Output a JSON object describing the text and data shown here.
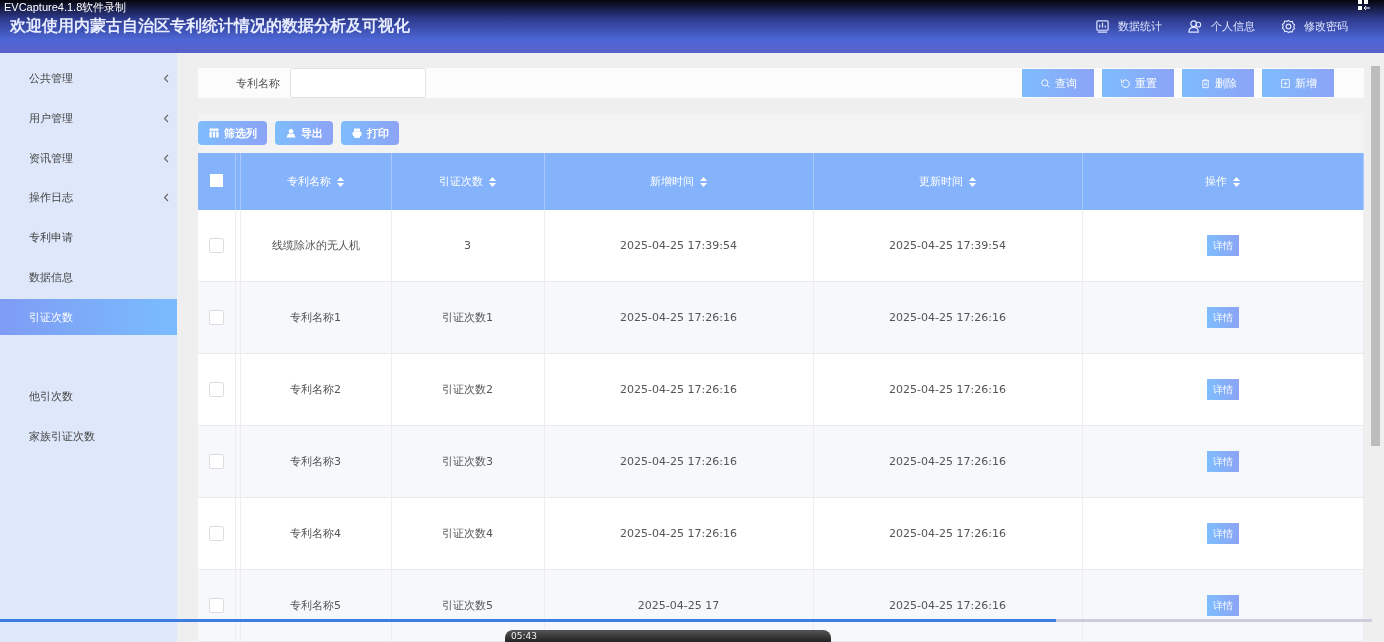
{
  "recorder": {
    "title": "EVCapture4.1.8软件录制"
  },
  "header": {
    "title": "欢迎使用内蒙古自治区专利统计情况的数据分析及可视化",
    "links": [
      {
        "kind": "stats",
        "label": "数据统计"
      },
      {
        "kind": "user",
        "label": "个人信息"
      },
      {
        "kind": "settings",
        "label": "修改密码"
      }
    ]
  },
  "sidebar": {
    "items": [
      {
        "label": "公共管理",
        "expandable": true,
        "selected": false
      },
      {
        "label": "用户管理",
        "expandable": true,
        "selected": false
      },
      {
        "label": "资讯管理",
        "expandable": true,
        "selected": false
      },
      {
        "label": "操作日志",
        "expandable": true,
        "selected": false
      },
      {
        "label": "专利申请",
        "expandable": false,
        "selected": false
      },
      {
        "label": "数据信息",
        "expandable": false,
        "selected": false
      },
      {
        "label": "引证次数",
        "expandable": false,
        "selected": true
      },
      {
        "expandable": false,
        "selected": false
      },
      {
        "label": "他引次数",
        "expandable": false,
        "selected": false
      },
      {
        "label": "家族引证次数",
        "expandable": false,
        "selected": false
      }
    ]
  },
  "search": {
    "label": "专利名称",
    "buttons": [
      {
        "kind": "search",
        "label": "查询"
      },
      {
        "kind": "reset",
        "label": "重置"
      },
      {
        "kind": "delete",
        "label": "删除"
      },
      {
        "kind": "add",
        "label": "新增"
      }
    ]
  },
  "toolbar": [
    {
      "kind": "columns",
      "label": "筛选列"
    },
    {
      "kind": "export",
      "label": "导出"
    },
    {
      "kind": "print",
      "label": "打印"
    }
  ],
  "table": {
    "select_all": {
      "checked": false
    },
    "columns": [
      "专利名称",
      "引证次数",
      "新增时间",
      "更新时间",
      "操作"
    ],
    "rows": [
      {
        "checked": false,
        "cells": [
          "线缆除冰的无人机",
          "3",
          "2025-04-25 17:39:54",
          "2025-04-25 17:39:54"
        ],
        "action": "详情"
      },
      {
        "checked": false,
        "cells": [
          "专利名称1",
          "引证次数1",
          "2025-04-25 17:26:16",
          "2025-04-25 17:26:16"
        ],
        "action": "详情"
      },
      {
        "checked": false,
        "cells": [
          "专利名称2",
          "引证次数2",
          "2025-04-25 17:26:16",
          "2025-04-25 17:26:16"
        ],
        "action": "详情"
      },
      {
        "checked": false,
        "cells": [
          "专利名称3",
          "引证次数3",
          "2025-04-25 17:26:16",
          "2025-04-25 17:26:16"
        ],
        "action": "详情"
      },
      {
        "checked": false,
        "cells": [
          "专利名称4",
          "引证次数4",
          "2025-04-25 17:26:16",
          "2025-04-25 17:26:16"
        ],
        "action": "详情"
      },
      {
        "checked": false,
        "cells": [
          "专利名称5",
          "引证次数5",
          "2025-04-25 17",
          "2025-04-25 17:26:16"
        ],
        "action": "详情"
      }
    ]
  },
  "player": {
    "time": "05:43",
    "level": 0.77
  }
}
